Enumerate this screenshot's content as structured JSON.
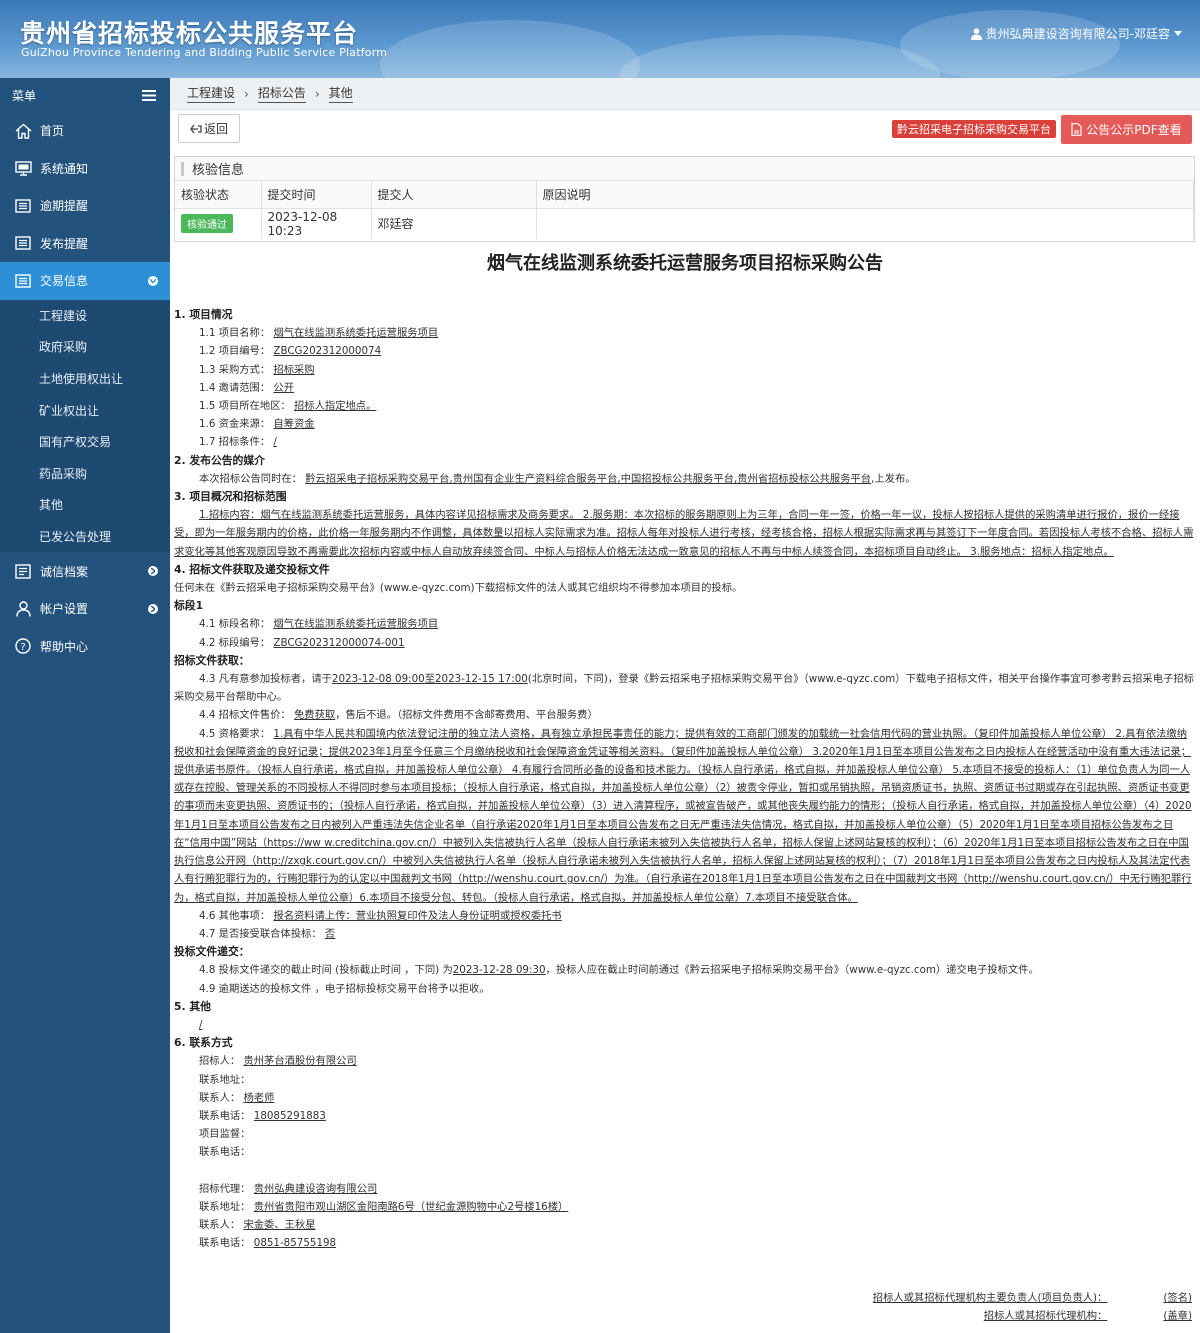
{
  "header": {
    "title": "贵州省招标投标公共服务平台",
    "subtitle": "GuiZhou Province Tendering and Bidding Public Service Platform",
    "user": "贵州弘典建设咨询有限公司-邓廷容"
  },
  "sidebar": {
    "menu_label": "菜单",
    "items": [
      {
        "label": "首页",
        "icon": "home-icon"
      },
      {
        "label": "系统通知",
        "icon": "monitor-icon"
      },
      {
        "label": "逾期提醒",
        "icon": "list-icon"
      },
      {
        "label": "发布提醒",
        "icon": "list-icon"
      },
      {
        "label": "交易信息",
        "icon": "list-icon"
      },
      {
        "label": "诚信档案",
        "icon": "document-icon"
      },
      {
        "label": "帐户设置",
        "icon": "user-icon"
      },
      {
        "label": "帮助中心",
        "icon": "help-icon"
      }
    ],
    "sub_items": [
      "工程建设",
      "政府采购",
      "土地使用权出让",
      "矿业权出让",
      "国有产权交易",
      "药品采购",
      "其他",
      "已发公告处理"
    ]
  },
  "breadcrumb": [
    "工程建设",
    "招标公告",
    "其他"
  ],
  "toolbar": {
    "back": "返回",
    "platform_tag": "黔云招采电子招标采购交易平台",
    "pdf_button": "公告公示PDF查看"
  },
  "verify": {
    "title": "核验信息",
    "headers": [
      "核验状态",
      "提交时间",
      "提交人",
      "原因说明"
    ],
    "status": "核验通过",
    "time": "2023-12-08 10:23",
    "submitter": "邓廷容",
    "reason": ""
  },
  "doc": {
    "title": "烟气在线监测系统委托运营服务项目招标采购公告",
    "s1": "1. 项目情况",
    "s1_rows": [
      {
        "k": "1.1 项目名称：",
        "v": "烟气在线监测系统委托运营服务项目"
      },
      {
        "k": "1.2 项目编号：",
        "v": "ZBCG202312000074"
      },
      {
        "k": "1.3 采购方式：",
        "v": "招标采购"
      },
      {
        "k": "1.4 邀请范围：",
        "v": "公开"
      },
      {
        "k": "1.5 项目所在地区：",
        "v": "招标人指定地点。"
      },
      {
        "k": "1.6 资金来源：",
        "v": "自筹资金"
      },
      {
        "k": "1.7 招标条件：",
        "v": "/"
      }
    ],
    "s2": "2. 发布公告的媒介",
    "s2_text_a": "本次招标公告同时在：",
    "s2_text_b": "黔云招采电子招标采购交易平台,贵州国有企业生产资料综合服务平台,中国招投标公共服务平台,贵州省招标投标公共服务平台",
    "s2_text_c": ",上发布。",
    "s3": "3. 项目概况和招标范围",
    "s3_text": "1.招标内容：烟气在线监测系统委托运营服务，具体内容详见招标需求及商务要求。 2.服务期：本次招标的服务期原则上为三年，合同一年一签，价格一年一议，投标人按招标人提供的采购清单进行报价，报价一经接受，即为一年服务期内的价格，此价格一年服务期内不作调整，具体数量以招标人实际需求为准。招标人每年对投标人进行考核，经考核合格，招标人根据实际需求再与其签订下一年度合同。若因投标人考核不合格、招标人需求变化等其他客观原因导致不再需要此次招标内容或中标人自动放弃续签合同、中标人与招标人价格无法达成一致意见的招标人不再与中标人续签合同，本招标项目自动终止。 3.服务地点：招标人指定地点。",
    "s4": "4. 招标文件获取及递交投标文件",
    "s4_text": "任何未在《黔云招采电子招标采购交易平台》(www.e-qyzc.com)下载招标文件的法人或其它组织均不得参加本项目的投标。",
    "seg": "标段1",
    "seg_rows": [
      {
        "k": "4.1 标段名称：",
        "v": "烟气在线监测系统委托运营服务项目"
      },
      {
        "k": "4.2 标段编号：",
        "v": "ZBCG202312000074-001"
      }
    ],
    "get_label": "招标文件获取：",
    "r43_a": "4.3 凡有意参加投标者，请于",
    "r43_b": "2023-12-08 09:00至2023-12-15 17:00",
    "r43_c": "(北京时间，下同)，登录《黔云招采电子招标采购交易平台》（www.e-qyzc.com）下载电子招标文件，相关平台操作事宜可参考黔云招采电子招标采购交易平台帮助中心。",
    "r44_a": "4.4 招标文件售价：",
    "r44_b": "免费获取",
    "r44_c": "，售后不退。（招标文件费用不含邮寄费用、平台服务费）",
    "r45_a": "4.5 资格要求：",
    "r45_b": "1.具有中华人民共和国境内依法登记注册的独立法人资格，具有独立承担民事责任的能力；提供有效的工商部门颁发的加载统一社会信用代码的营业执照。（复印件加盖投标人单位公章） 2.具有依法缴纳税收和社会保障资金的良好记录；提供2023年1月至今任意三个月缴纳税收和社会保障资金凭证等相关资料。（复印件加盖投标人单位公章） 3.2020年1月1日至本项目公告发布之日内投标人在经营活动中没有重大违法记录；提供承诺书原件。（投标人自行承诺，格式自拟，并加盖投标人单位公章） 4.有履行合同所必备的设备和技术能力。（投标人自行承诺，格式自拟，并加盖投标人单位公章） 5.本项目不接受的投标人：（1）单位负责人为同一人或存在控股、管理关系的不同投标人不得同时参与本项目投标；（投标人自行承诺，格式自拟，并加盖投标人单位公章）（2）被责令停业，暂扣或吊销执照，吊销资质证书，执照、资质证书过期或存在引起执照、资质证书变更的事项而未变更执照、资质证书的；（投标人自行承诺，格式自拟，并加盖投标人单位公章）（3）进入清算程序，或被宣告破产，或其他丧失履约能力的情形；（投标人自行承诺，格式自拟，并加盖投标人单位公章）（4）2020年1月1日至本项目公告发布之日内被列入严重违法失信企业名单（自行承诺2020年1月1日至本项目公告发布之日无严重违法失信情况，格式自拟，并加盖投标人单位公章）（5）2020年1月1日至本项目招标公告发布之日在“信用中国”网站（https://ww w.creditchina.gov.cn/）中被列入失信被执行人名单（投标人自行承诺未被列入失信被执行人名单，招标人保留上述网站复核的权利）；（6）2020年1月1日至本项目招标公告发布之日在中国执行信息公开网（http://zxgk.court.gov.cn/）中被列入失信被执行人名单（投标人自行承诺未被列入失信被执行人名单，招标人保留上述网站复核的权利）；（7）2018年1月1日至本项目公告发布之日内投标人及其法定代表人有行贿犯罪行为的，行贿犯罪行为的认定以中国裁判文书网（http://wenshu.court.gov.cn/）为准。（自行承诺在2018年1月1日至本项目公告发布之日在中国裁判文书网（http://wenshu.court.gov.cn/）中无行贿犯罪行为，格式自拟，并加盖投标人单位公章）6.本项目不接受分包、转包。（投标人自行承诺，格式自拟，并加盖投标人单位公章）7.本项目不接受联合体。",
    "r46_a": "4.6 其他事项：",
    "r46_b": "报名资料请上传：营业执照复印件及法人身份证明或授权委托书",
    "r47_a": "4.7 是否接受联合体投标：",
    "r47_b": "否",
    "submit_label": "投标文件递交：",
    "r48_a": "4.8 投标文件递交的截止时间 (投标截止时间 ，下同) 为",
    "r48_b": "2023-12-28 09:30",
    "r48_c": "，投标人应在截止时间前通过《黔云招采电子招标采购交易平台》（www.e-qyzc.com）递交电子投标文件。",
    "r49": "4.9 逾期送达的投标文件 ，电子招标投标交易平台将予以拒收。",
    "s5": "5. 其他",
    "s5_text": "/",
    "s6": "6. 联系方式",
    "contact1": [
      {
        "k": "招标人：",
        "v": "贵州茅台酒股份有限公司"
      },
      {
        "k": "联系地址：",
        "v": ""
      },
      {
        "k": "联系人：",
        "v": "杨老师"
      },
      {
        "k": "联系电话：",
        "v": "18085291883"
      },
      {
        "k": "项目监督：",
        "v": ""
      },
      {
        "k": "联系电话：",
        "v": ""
      }
    ],
    "contact2": [
      {
        "k": "招标代理：",
        "v": "贵州弘典建设咨询有限公司"
      },
      {
        "k": "联系地址：",
        "v": "贵州省贵阳市观山湖区金阳南路6号（世纪金源购物中心2号楼16楼）"
      },
      {
        "k": "联系人：",
        "v": "宋金委、王秋星"
      },
      {
        "k": "联系电话：",
        "v": "0851-85755198"
      }
    ],
    "sign1": "招标人或其招标代理机构主要负责人(项目负责人)：",
    "sign1_end": "(签名)",
    "sign2": "招标人或其招标代理机构：",
    "sign2_end": "(盖章)"
  },
  "colors": {
    "sidebar": "#23527c",
    "sidebar_active": "#2d8fd5",
    "pdf_button": "#e45a59",
    "badge": "#4cb85c",
    "platform_tag": "#d9403a"
  }
}
